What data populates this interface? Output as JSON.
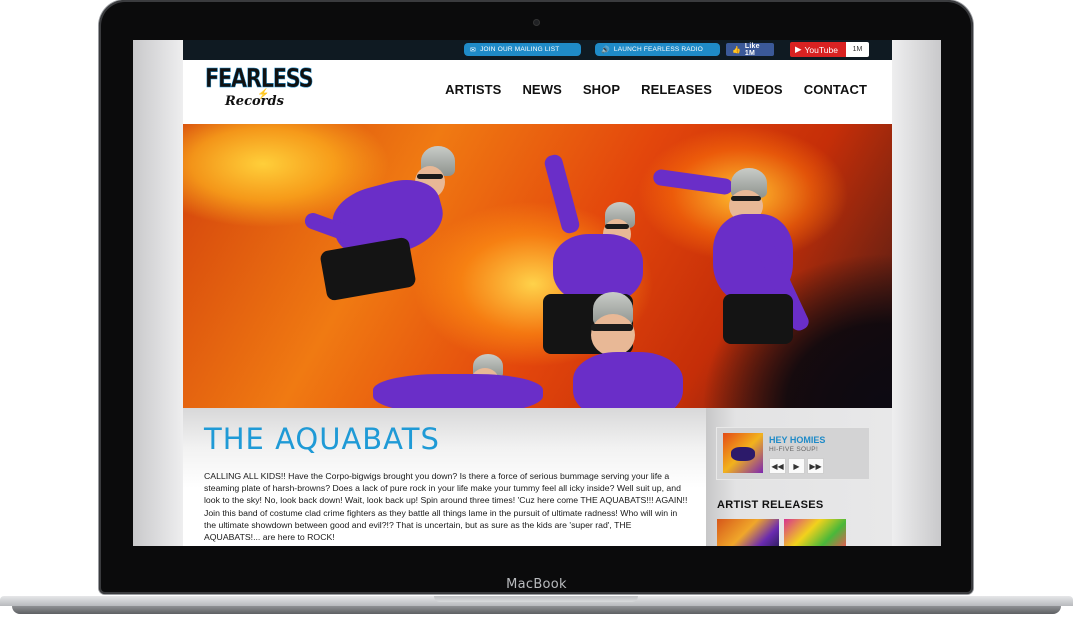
{
  "device": {
    "label": "MacBook"
  },
  "topbar": {
    "mailing_list": "JOIN OUR MAILING LIST",
    "radio": "LAUNCH FEARLESS RADIO",
    "facebook_like": "Like 1M",
    "youtube_label": "YouTube",
    "youtube_count": "1M"
  },
  "logo": {
    "top": "FEARLESS",
    "bottom": "Records"
  },
  "nav": {
    "items": [
      "ARTISTS",
      "NEWS",
      "SHOP",
      "RELEASES",
      "VIDEOS",
      "CONTACT"
    ]
  },
  "artist": {
    "name": "THE AQUABATS",
    "bio": "CALLING ALL KIDS!! Have the Corpo-bigwigs brought you down? Is there a force of serious bummage serving your life a steaming plate of harsh-browns? Does a lack of pure rock in your life make your tummy feel all icky inside? Well suit up, and look to the sky! No, look back down! Wait, look back up! Spin around three times!  'Cuz here come THE AQUABATS!!! AGAIN!! Join this band of costume clad crime fighters as they battle all things lame in the pursuit of ultimate radness! Who will win in the ultimate showdown between good and evil?!? That is uncertain, but as sure as the kids are 'super rad', THE AQUABATS!... are here to ROCK!"
  },
  "player": {
    "track_title": "HEY HOMIES",
    "album": "HI-FIVE SOUP!"
  },
  "sidebar": {
    "releases_heading": "ARTIST RELEASES"
  },
  "colors": {
    "accent": "#1f9ad6",
    "topbar": "#0f1a22",
    "youtube": "#d92222",
    "facebook": "#3b5998"
  },
  "icons": {
    "mail": "envelope-icon",
    "radio": "speaker-icon",
    "facebook": "facebook-icon",
    "youtube": "youtube-play-icon"
  }
}
